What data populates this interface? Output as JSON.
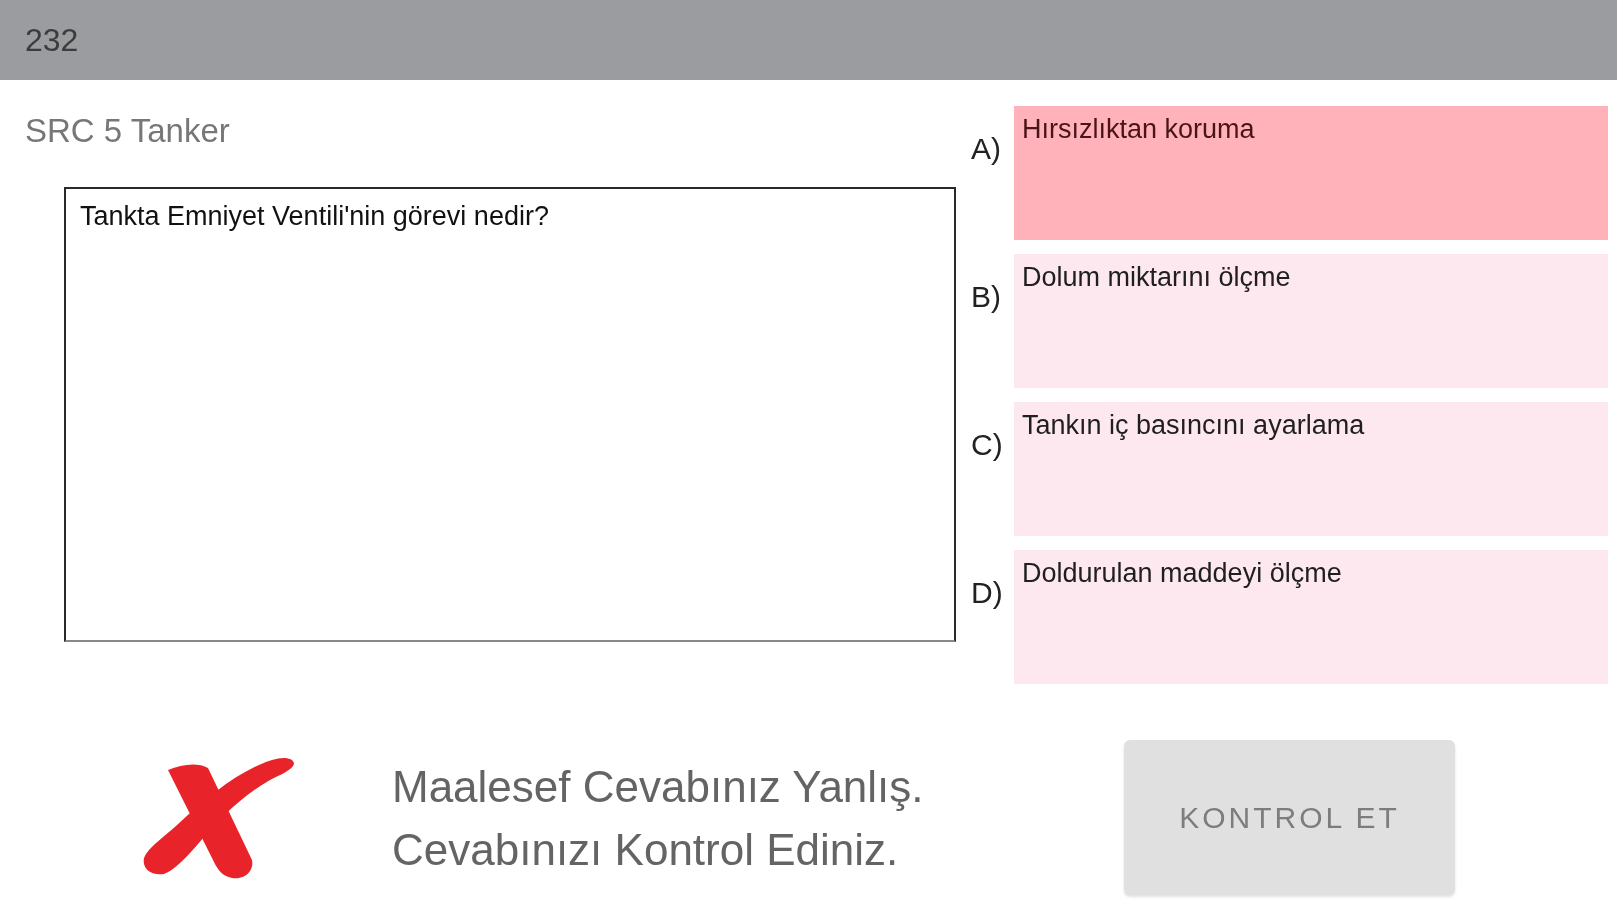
{
  "header": {
    "title": "232"
  },
  "quiz": {
    "category": "SRC 5 Tanker",
    "question": "Tankta Emniyet Ventili'nin görevi nedir?"
  },
  "options": [
    {
      "letter": "A)",
      "text": "Hırsızlıktan koruma",
      "selected": true
    },
    {
      "letter": "B)",
      "text": "Dolum miktarını ölçme",
      "selected": false
    },
    {
      "letter": "C)",
      "text": "Tankın iç basıncını ayarlama",
      "selected": false
    },
    {
      "letter": "D)",
      "text": "Doldurulan maddeyi ölçme",
      "selected": false
    }
  ],
  "result": {
    "kind": "wrong",
    "lines": [
      "Maalesef Cevabınız Yanlış.",
      "Cevabınızı Kontrol Ediniz."
    ]
  },
  "check_button": {
    "label": "KONTROL ET",
    "disabled": true
  }
}
